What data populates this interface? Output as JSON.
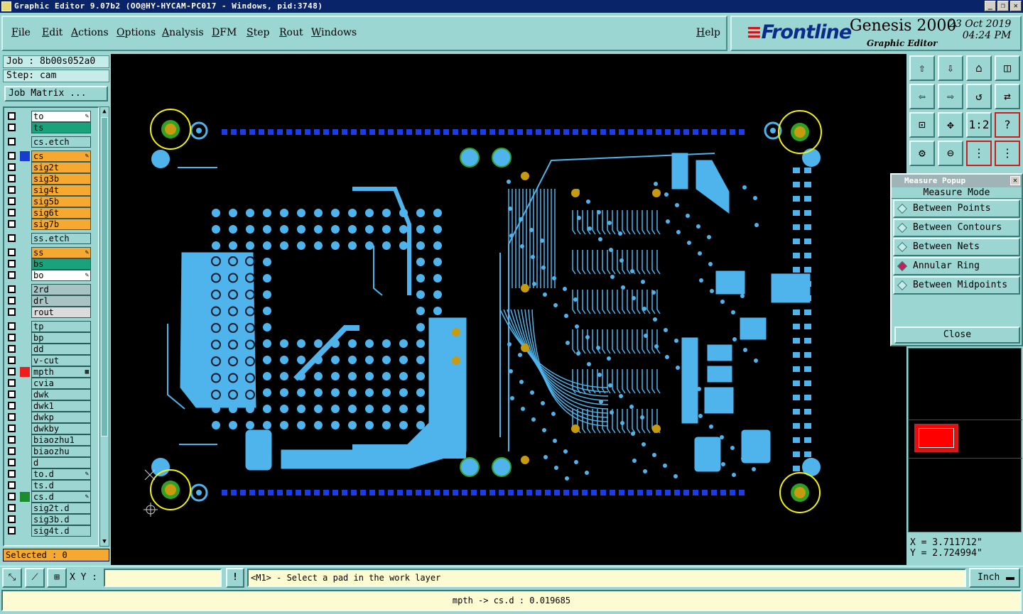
{
  "window": {
    "title": "Graphic Editor 9.07b2 (OO@HY-HYCAM-PC017 - Windows, pid:3748)",
    "buttons": [
      "_",
      "❐",
      "✕"
    ]
  },
  "menu": {
    "items": [
      "File",
      "Edit",
      "Actions",
      "Options",
      "Analysis",
      "DFM",
      "Step",
      "Rout",
      "Windows"
    ],
    "help": "Help"
  },
  "brand": {
    "logo": "Frontline",
    "product": "Genesis 2000",
    "subtitle": "Graphic Editor",
    "date": "23 Oct 2019",
    "time": "04:24 PM"
  },
  "job": {
    "job_label": "Job : 8b00s052a0",
    "step_label": "Step: cam",
    "matrix_button": "Job Matrix ..."
  },
  "layers": [
    {
      "name": "to",
      "color": "#ffffff",
      "swatch": "",
      "mark": "pen",
      "gap": false
    },
    {
      "name": "ts",
      "color": "#1aa37a",
      "swatch": "",
      "mark": "",
      "gap": false
    },
    {
      "name": "cs.etch",
      "color": "#9cd6d2",
      "swatch": "",
      "mark": "",
      "gap": true
    },
    {
      "name": "cs",
      "color": "#f5a930",
      "swatch": "#1a3ccc",
      "mark": "pen",
      "gap": true
    },
    {
      "name": "sig2t",
      "color": "#f5a930",
      "swatch": "",
      "mark": "",
      "gap": false
    },
    {
      "name": "sig3b",
      "color": "#f5a930",
      "swatch": "",
      "mark": "",
      "gap": false
    },
    {
      "name": "sig4t",
      "color": "#f5a930",
      "swatch": "",
      "mark": "",
      "gap": false
    },
    {
      "name": "sig5b",
      "color": "#f5a930",
      "swatch": "",
      "mark": "",
      "gap": false
    },
    {
      "name": "sig6t",
      "color": "#f5a930",
      "swatch": "",
      "mark": "",
      "gap": false
    },
    {
      "name": "sig7b",
      "color": "#f5a930",
      "swatch": "",
      "mark": "",
      "gap": false
    },
    {
      "name": "ss.etch",
      "color": "#9cd6d2",
      "swatch": "",
      "mark": "",
      "gap": true
    },
    {
      "name": "ss",
      "color": "#f5a930",
      "swatch": "",
      "mark": "pen",
      "gap": true
    },
    {
      "name": "bs",
      "color": "#1aa37a",
      "swatch": "",
      "mark": "",
      "gap": false
    },
    {
      "name": "bo",
      "color": "#ffffff",
      "swatch": "",
      "mark": "pen",
      "gap": false
    },
    {
      "name": "2rd",
      "color": "#a9c4c4",
      "swatch": "",
      "mark": "",
      "gap": true
    },
    {
      "name": "drl",
      "color": "#a9c4c4",
      "swatch": "",
      "mark": "",
      "gap": false
    },
    {
      "name": "rout",
      "color": "#dcdcdc",
      "swatch": "",
      "mark": "",
      "gap": false
    },
    {
      "name": "tp",
      "color": "#9cd6d2",
      "swatch": "",
      "mark": "",
      "gap": true
    },
    {
      "name": "bp",
      "color": "#9cd6d2",
      "swatch": "",
      "mark": "",
      "gap": false
    },
    {
      "name": "dd",
      "color": "#9cd6d2",
      "swatch": "",
      "mark": "",
      "gap": false
    },
    {
      "name": "v-cut",
      "color": "#9cd6d2",
      "swatch": "",
      "mark": "",
      "gap": false
    },
    {
      "name": "mpth",
      "color": "#9cd6d2",
      "swatch": "#ee1c1c",
      "mark": "grid",
      "gap": false
    },
    {
      "name": "cvia",
      "color": "#9cd6d2",
      "swatch": "",
      "mark": "",
      "gap": false
    },
    {
      "name": "dwk",
      "color": "#9cd6d2",
      "swatch": "",
      "mark": "",
      "gap": false
    },
    {
      "name": "dwk1",
      "color": "#9cd6d2",
      "swatch": "",
      "mark": "",
      "gap": false
    },
    {
      "name": "dwkp",
      "color": "#9cd6d2",
      "swatch": "",
      "mark": "",
      "gap": false
    },
    {
      "name": "dwkby",
      "color": "#9cd6d2",
      "swatch": "",
      "mark": "",
      "gap": false
    },
    {
      "name": "biaozhu1",
      "color": "#9cd6d2",
      "swatch": "",
      "mark": "",
      "gap": false
    },
    {
      "name": "biaozhu",
      "color": "#9cd6d2",
      "swatch": "",
      "mark": "",
      "gap": false
    },
    {
      "name": "d",
      "color": "#9cd6d2",
      "swatch": "",
      "mark": "",
      "gap": false
    },
    {
      "name": "to.d",
      "color": "#9cd6d2",
      "swatch": "",
      "mark": "pen",
      "gap": false
    },
    {
      "name": "ts.d",
      "color": "#9cd6d2",
      "swatch": "",
      "mark": "",
      "gap": false
    },
    {
      "name": "cs.d",
      "color": "#9cd6d2",
      "swatch": "#1e8c2e",
      "mark": "pen",
      "gap": false
    },
    {
      "name": "sig2t.d",
      "color": "#9cd6d2",
      "swatch": "",
      "mark": "",
      "gap": false
    },
    {
      "name": "sig3b.d",
      "color": "#9cd6d2",
      "swatch": "",
      "mark": "",
      "gap": false
    },
    {
      "name": "sig4t.d",
      "color": "#9cd6d2",
      "swatch": "",
      "mark": "",
      "gap": false
    }
  ],
  "selected": "Selected : 0",
  "board": {
    "copper_color": "#4fb4ec",
    "fiducial_ring": "#f2f20a",
    "pad_fill": "#c79a10",
    "pad_green": "#32a024",
    "edge_dots": "#1c3ce8"
  },
  "tools": {
    "labels": [
      "⇧",
      "⇩",
      "⌂",
      "◫",
      "⇦",
      "⇨",
      "↺",
      "⇄",
      "⊡",
      "✥",
      "1:2",
      "?",
      "⚙",
      "⊖",
      "⋮",
      "⋮"
    ]
  },
  "measure_popup": {
    "title": "Measure Popup",
    "close_x": "✕",
    "mode_label": "Measure Mode",
    "options": [
      "Between Points",
      "Between Contours",
      "Between Nets",
      "Annular Ring",
      "Between Midpoints"
    ],
    "selected_option": "Annular Ring",
    "close_button": "Close"
  },
  "coords": {
    "x": "X = 3.711712\"",
    "y": "Y = 2.724994\""
  },
  "bottom": {
    "xy_label": "X Y :",
    "xy_value": "",
    "warn": "!",
    "prompt": "<M1> - Select a pad in the work layer",
    "unit": "Inch"
  },
  "status": "mpth -> cs.d : 0.019685"
}
